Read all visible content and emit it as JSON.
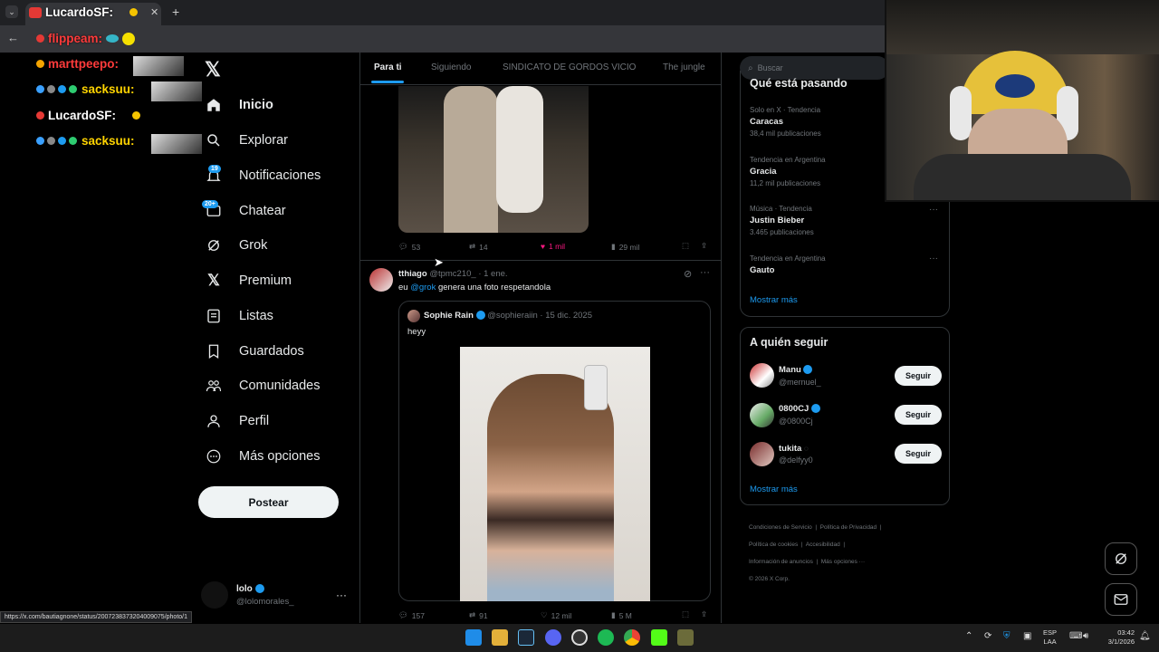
{
  "browser": {
    "tab_title": "LucardoSF:",
    "new_tab": "+",
    "status_url": "https://x.com/bautiagnone/status/2007238373204009075/photo/1"
  },
  "chat": [
    {
      "name": "flippeam:",
      "color": "#ff3b3b"
    },
    {
      "name": "marttpeepo:",
      "color": "#ff3b3b"
    },
    {
      "name": "sacksuu:",
      "color": "#ffd400"
    },
    {
      "name": "LucardoSF:",
      "color": "#ffffff"
    },
    {
      "name": "sacksuu:",
      "color": "#ffd400"
    }
  ],
  "nav": {
    "items": [
      {
        "label": "Inicio",
        "icon": "home-icon"
      },
      {
        "label": "Explorar",
        "icon": "search-icon"
      },
      {
        "label": "Notificaciones",
        "icon": "bell-icon",
        "badge": "19"
      },
      {
        "label": "Chatear",
        "icon": "mail-icon",
        "badge": "20+"
      },
      {
        "label": "Grok",
        "icon": "grok-icon"
      },
      {
        "label": "Premium",
        "icon": "x-icon"
      },
      {
        "label": "Listas",
        "icon": "list-icon"
      },
      {
        "label": "Guardados",
        "icon": "bookmark-icon"
      },
      {
        "label": "Comunidades",
        "icon": "people-icon"
      },
      {
        "label": "Perfil",
        "icon": "person-icon"
      },
      {
        "label": "Más opciones",
        "icon": "more-circle-icon"
      }
    ],
    "post_label": "Postear",
    "account": {
      "name": "lolo",
      "handle": "@lolomorales_"
    }
  },
  "feed": {
    "tabs": [
      "Para ti",
      "Siguiendo",
      "SINDICATO DE GORDOS VICIO",
      "The jungle"
    ],
    "first_tweet_actions": {
      "replies": "53",
      "retweets": "14",
      "likes": "1 mil",
      "views": "29 mil"
    },
    "tweet": {
      "name": "tthiago",
      "handle": "@tpmc210_",
      "time": "· 1 ene.",
      "text_prefix": "eu ",
      "mention": "@grok",
      "text_suffix": " genera una foto respetandola",
      "quote": {
        "name": "Sophie Rain",
        "handle": "@sophieraiin",
        "time": "· 15 dic. 2025",
        "text": "heyy"
      },
      "actions": {
        "replies": "157",
        "retweets": "91",
        "likes": "12 mil",
        "views": "5 M"
      }
    }
  },
  "search": {
    "placeholder": "Buscar"
  },
  "trends": {
    "title": "Qué está pasando",
    "items": [
      {
        "meta": "Solo en X · Tendencia",
        "name": "Caracas",
        "posts": "38,4 mil publicaciones"
      },
      {
        "meta": "Tendencia en Argentina",
        "name": "Gracia",
        "posts": "11,2 mil publicaciones"
      },
      {
        "meta": "Música · Tendencia",
        "name": "Justin Bieber",
        "posts": "3.465 publicaciones"
      },
      {
        "meta": "Tendencia en Argentina",
        "name": "Gauto",
        "posts": ""
      }
    ],
    "show_more": "Mostrar más"
  },
  "follow": {
    "title": "A quién seguir",
    "items": [
      {
        "name": "Manu",
        "handle": "@mernuel_",
        "button": "Seguir"
      },
      {
        "name": "0800CJ",
        "handle": "@0800Cj",
        "button": "Seguir"
      },
      {
        "name": "tukita",
        "handle": "@delfyy0",
        "button": "Seguir"
      }
    ],
    "show_more": "Mostrar más"
  },
  "footer": {
    "links": [
      "Condiciones de Servicio",
      "Política de Privacidad",
      "Política de cookies",
      "Accesibilidad",
      "Información de anuncios",
      "Más opciones ···"
    ],
    "copyright": "© 2026 X Corp."
  },
  "taskbar": {
    "lang": "ESP",
    "layout": "LAA",
    "time": "03:42",
    "date": "3/1/2026"
  },
  "colors": {
    "accent": "#1d9bf0",
    "like": "#f91880",
    "border": "#2f3336"
  }
}
